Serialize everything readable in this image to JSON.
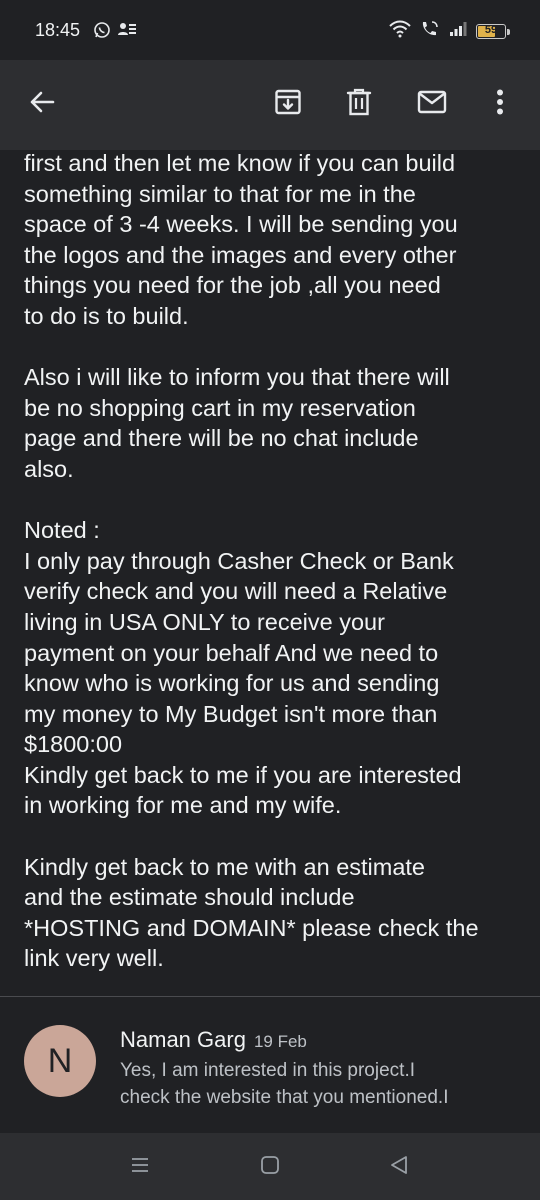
{
  "status_bar": {
    "time": "18:45",
    "battery": "59"
  },
  "toolbar": {
    "back_icon": "arrow-back-icon",
    "archive_icon": "archive-icon",
    "delete_icon": "trash-icon",
    "mark_unread_icon": "mail-icon",
    "more_icon": "more-vert-icon"
  },
  "email": {
    "body": "first and then let me know if you can build\nsomething similar to that for me in the\nspace of 3 -4 weeks. I will be sending you\nthe logos and the images and every other\nthings you need for the job ,all you need\nto do is to build.\n\nAlso i will like to inform you that there will\nbe no shopping cart in my reservation\npage and there will be no chat include\nalso.\n\nNoted :\nI only pay through Casher Check or Bank\nverify check and you will need a Relative\nliving in USA ONLY to receive your\npayment on your behalf And we need to\nknow who is working for us and sending\nmy money to My Budget isn't more than\n$1800:00\nKindly get back to me if you are interested\nin working for me and my wife.\n\nKindly get back to me with an estimate\nand the estimate should include\n*HOSTING and DOMAIN* please check the\nlink very well."
  },
  "reply": {
    "avatar_letter": "N",
    "sender": "Naman Garg",
    "date": "19 Feb",
    "snippet_line1": "Yes, I am interested in this project.I",
    "snippet_line2": "check the website that you mentioned.I"
  },
  "colors": {
    "background": "#202124",
    "toolbar": "#2d2e31",
    "avatar": "#caa698",
    "battery": "#e0b24b"
  }
}
